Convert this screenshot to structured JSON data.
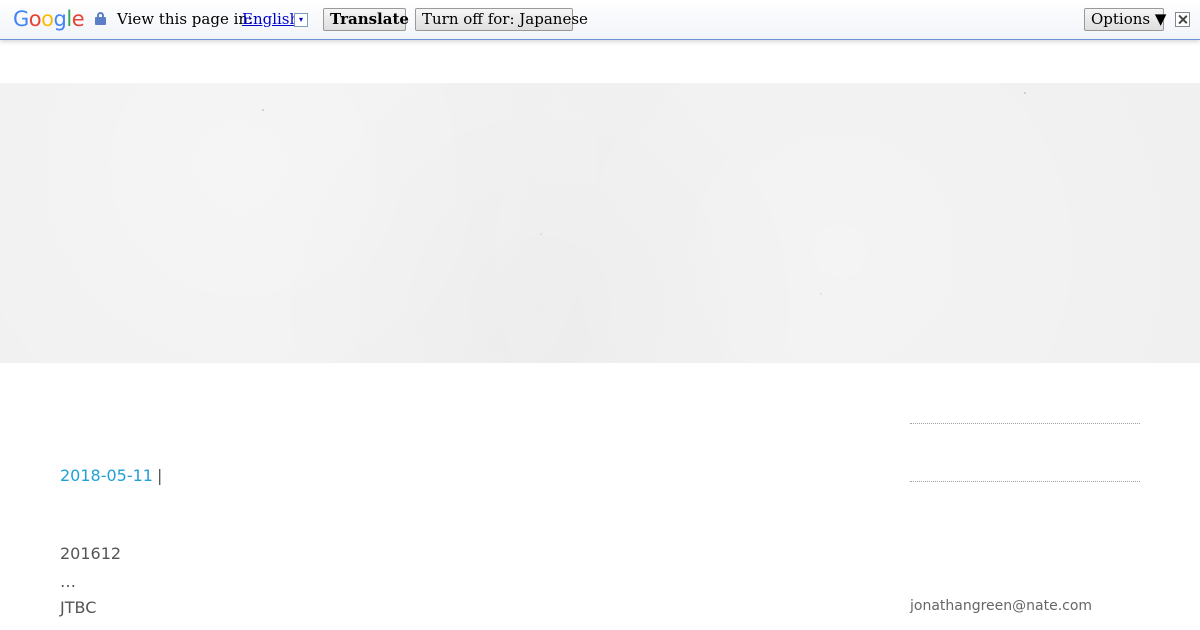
{
  "translate_bar": {
    "logo_letters": [
      {
        "char": "G",
        "color": "#4285f4"
      },
      {
        "char": "o",
        "color": "#ea4335"
      },
      {
        "char": "o",
        "color": "#fbbc05"
      },
      {
        "char": "g",
        "color": "#4285f4"
      },
      {
        "char": "l",
        "color": "#34a853"
      },
      {
        "char": "e",
        "color": "#ea4335"
      }
    ],
    "prompt": "View this page in:",
    "language": "English",
    "dropdown_glyph": "▾",
    "translate_label": "Translate",
    "turn_off_label": "Turn off for: Japanese",
    "options_label": "Options ▼",
    "lock_icon": "lock-icon",
    "close_icon": "close-icon"
  },
  "post": {
    "date": "2018-05-11",
    "separator": "|",
    "lines": [
      "201612",
      "…",
      "JTBC"
    ],
    "date_color": "#21a0d8"
  },
  "sidebar": {
    "email": "jonathangreen@nate.com"
  }
}
